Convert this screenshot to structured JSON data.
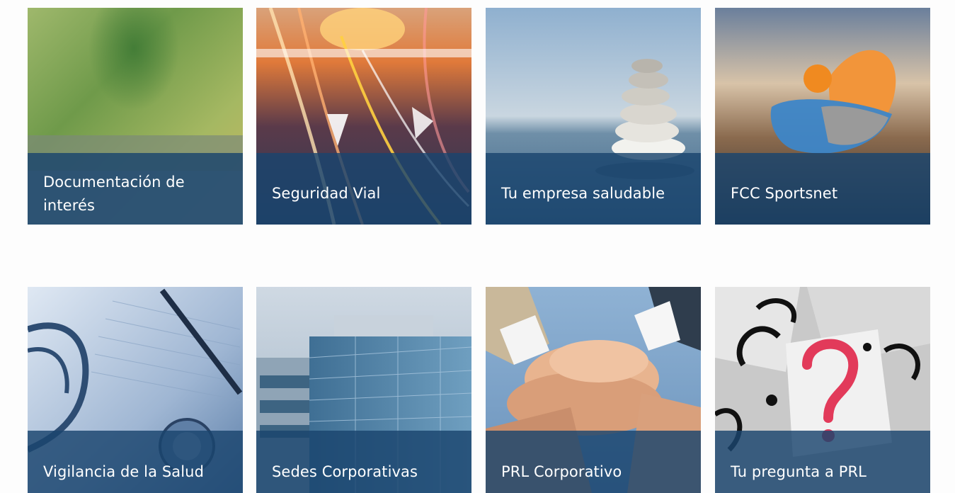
{
  "tiles": [
    {
      "label": "Documentación de interés"
    },
    {
      "label": "Seguridad Vial"
    },
    {
      "label": "Tu empresa saludable"
    },
    {
      "label": "FCC Sportsnet"
    },
    {
      "label": "Vigilancia de la Salud"
    },
    {
      "label": "Sedes Corporativas"
    },
    {
      "label": "PRL Corporativo"
    },
    {
      "label": "Tu pregunta a PRL"
    }
  ],
  "colors": {
    "caption_overlay": "#1a446e",
    "caption_text": "#ffffff",
    "background": "#fdfdfd"
  }
}
